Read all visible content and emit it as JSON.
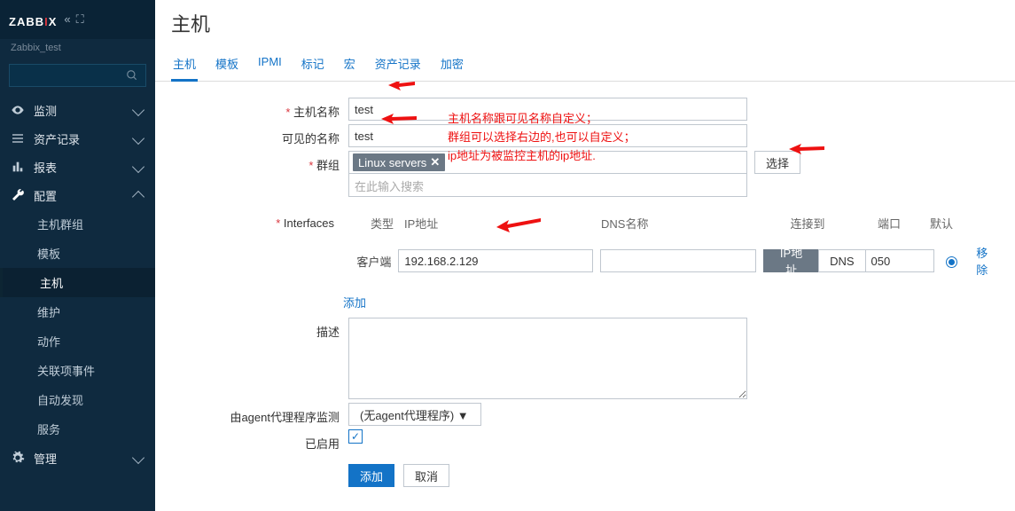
{
  "app": {
    "logo_a": "ZABB",
    "logo_b": "I",
    "logo_c": "X",
    "tenant": "Zabbix_test"
  },
  "sidebar": {
    "items": [
      {
        "label": "监测",
        "icon": "eye"
      },
      {
        "label": "资产记录",
        "icon": "list"
      },
      {
        "label": "报表",
        "icon": "chart"
      },
      {
        "label": "配置",
        "icon": "wrench",
        "expanded": true
      },
      {
        "label": "管理",
        "icon": "gear"
      }
    ],
    "config_sub": [
      {
        "label": "主机群组"
      },
      {
        "label": "模板"
      },
      {
        "label": "主机",
        "selected": true
      },
      {
        "label": "维护"
      },
      {
        "label": "动作"
      },
      {
        "label": "关联项事件"
      },
      {
        "label": "自动发现"
      },
      {
        "label": "服务"
      }
    ]
  },
  "page": {
    "title": "主机"
  },
  "tabs": [
    {
      "label": "主机",
      "active": true
    },
    {
      "label": "模板"
    },
    {
      "label": "IPMI"
    },
    {
      "label": "标记"
    },
    {
      "label": "宏"
    },
    {
      "label": "资产记录"
    },
    {
      "label": "加密"
    }
  ],
  "form": {
    "hostname": {
      "label": "主机名称",
      "value": "test"
    },
    "visible": {
      "label": "可见的名称",
      "value": "test"
    },
    "groups": {
      "label": "群组",
      "tag": "Linux servers",
      "placeholder": "在此输入搜索",
      "select_btn": "选择"
    },
    "interfaces": {
      "label": "Interfaces",
      "head": {
        "type": "类型",
        "ip": "IP地址",
        "dns": "DNS名称",
        "conn": "连接到",
        "port": "端口",
        "def": "默认"
      },
      "row": {
        "type": "客户端",
        "ip": "192.168.2.129",
        "dns": "",
        "conn_ip": "IP地址",
        "conn_dns": "DNS",
        "port": "050",
        "remove": "移除"
      },
      "add": "添加"
    },
    "desc": {
      "label": "描述",
      "value": ""
    },
    "agent": {
      "label": "由agent代理程序监测",
      "value": "(无agent代理程序) ▼"
    },
    "enabled": {
      "label": "已启用",
      "checked": true
    },
    "actions": {
      "add": "添加",
      "cancel": "取消"
    }
  },
  "annotations": {
    "line1": "主机名称跟可见名称自定义；",
    "line2": "群组可以选择右边的,也可以自定义；",
    "line3": "ip地址为被监控主机的ip地址."
  }
}
